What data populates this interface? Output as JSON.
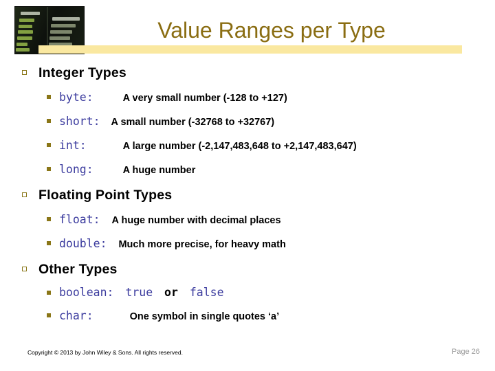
{
  "slide": {
    "title": "Value Ranges per Type",
    "title_color": "#8a6d12",
    "accent_bar_color": "#fae8a0",
    "bullet_color": "#8a7617",
    "code_color": "#3b3b9e",
    "image_alt": "airport-flight-departures-board"
  },
  "sections": [
    {
      "heading": "Integer Types",
      "items": [
        {
          "code": "byte:",
          "desc": "A very small number (-128 to +127)"
        },
        {
          "code": "short:",
          "desc": "A small number (-32768 to +32767)"
        },
        {
          "code": "int:",
          "desc": "A large number (-2,147,483,648 to +2,147,483,647)"
        },
        {
          "code": "long:",
          "desc": "A huge number"
        }
      ]
    },
    {
      "heading": "Floating Point Types",
      "items": [
        {
          "code": "float:",
          "desc": "A huge number with decimal places"
        },
        {
          "code": "double:",
          "desc": "Much more precise, for heavy math"
        }
      ]
    },
    {
      "heading": "Other Types",
      "items": [
        {
          "code": "boolean:",
          "value_true": "true",
          "conjunction": "or",
          "value_false": "false"
        },
        {
          "code": "char:",
          "desc": "One symbol in single quotes ‘a’"
        }
      ]
    }
  ],
  "footer": {
    "copyright": "Copyright © 2013 by John Wiley & Sons.  All rights reserved.",
    "page_label": "Page 26"
  }
}
